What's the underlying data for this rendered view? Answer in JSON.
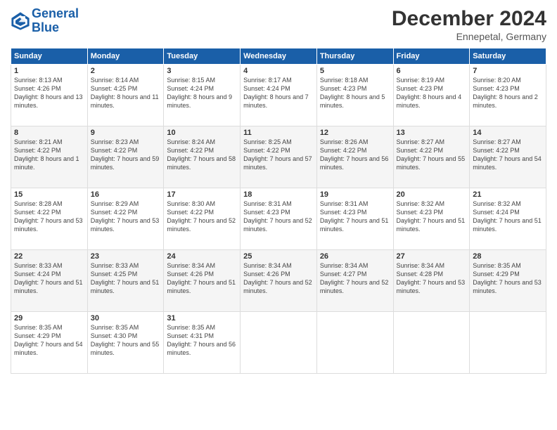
{
  "logo": {
    "line1": "General",
    "line2": "Blue"
  },
  "header": {
    "title": "December 2024",
    "subtitle": "Ennepetal, Germany"
  },
  "weekdays": [
    "Sunday",
    "Monday",
    "Tuesday",
    "Wednesday",
    "Thursday",
    "Friday",
    "Saturday"
  ],
  "weeks": [
    [
      {
        "day": "1",
        "sunrise": "8:13 AM",
        "sunset": "4:26 PM",
        "daylight": "8 hours and 13 minutes."
      },
      {
        "day": "2",
        "sunrise": "8:14 AM",
        "sunset": "4:25 PM",
        "daylight": "8 hours and 11 minutes."
      },
      {
        "day": "3",
        "sunrise": "8:15 AM",
        "sunset": "4:24 PM",
        "daylight": "8 hours and 9 minutes."
      },
      {
        "day": "4",
        "sunrise": "8:17 AM",
        "sunset": "4:24 PM",
        "daylight": "8 hours and 7 minutes."
      },
      {
        "day": "5",
        "sunrise": "8:18 AM",
        "sunset": "4:23 PM",
        "daylight": "8 hours and 5 minutes."
      },
      {
        "day": "6",
        "sunrise": "8:19 AM",
        "sunset": "4:23 PM",
        "daylight": "8 hours and 4 minutes."
      },
      {
        "day": "7",
        "sunrise": "8:20 AM",
        "sunset": "4:23 PM",
        "daylight": "8 hours and 2 minutes."
      }
    ],
    [
      {
        "day": "8",
        "sunrise": "8:21 AM",
        "sunset": "4:22 PM",
        "daylight": "8 hours and 1 minute."
      },
      {
        "day": "9",
        "sunrise": "8:23 AM",
        "sunset": "4:22 PM",
        "daylight": "7 hours and 59 minutes."
      },
      {
        "day": "10",
        "sunrise": "8:24 AM",
        "sunset": "4:22 PM",
        "daylight": "7 hours and 58 minutes."
      },
      {
        "day": "11",
        "sunrise": "8:25 AM",
        "sunset": "4:22 PM",
        "daylight": "7 hours and 57 minutes."
      },
      {
        "day": "12",
        "sunrise": "8:26 AM",
        "sunset": "4:22 PM",
        "daylight": "7 hours and 56 minutes."
      },
      {
        "day": "13",
        "sunrise": "8:27 AM",
        "sunset": "4:22 PM",
        "daylight": "7 hours and 55 minutes."
      },
      {
        "day": "14",
        "sunrise": "8:27 AM",
        "sunset": "4:22 PM",
        "daylight": "7 hours and 54 minutes."
      }
    ],
    [
      {
        "day": "15",
        "sunrise": "8:28 AM",
        "sunset": "4:22 PM",
        "daylight": "7 hours and 53 minutes."
      },
      {
        "day": "16",
        "sunrise": "8:29 AM",
        "sunset": "4:22 PM",
        "daylight": "7 hours and 53 minutes."
      },
      {
        "day": "17",
        "sunrise": "8:30 AM",
        "sunset": "4:22 PM",
        "daylight": "7 hours and 52 minutes."
      },
      {
        "day": "18",
        "sunrise": "8:31 AM",
        "sunset": "4:23 PM",
        "daylight": "7 hours and 52 minutes."
      },
      {
        "day": "19",
        "sunrise": "8:31 AM",
        "sunset": "4:23 PM",
        "daylight": "7 hours and 51 minutes."
      },
      {
        "day": "20",
        "sunrise": "8:32 AM",
        "sunset": "4:23 PM",
        "daylight": "7 hours and 51 minutes."
      },
      {
        "day": "21",
        "sunrise": "8:32 AM",
        "sunset": "4:24 PM",
        "daylight": "7 hours and 51 minutes."
      }
    ],
    [
      {
        "day": "22",
        "sunrise": "8:33 AM",
        "sunset": "4:24 PM",
        "daylight": "7 hours and 51 minutes."
      },
      {
        "day": "23",
        "sunrise": "8:33 AM",
        "sunset": "4:25 PM",
        "daylight": "7 hours and 51 minutes."
      },
      {
        "day": "24",
        "sunrise": "8:34 AM",
        "sunset": "4:26 PM",
        "daylight": "7 hours and 51 minutes."
      },
      {
        "day": "25",
        "sunrise": "8:34 AM",
        "sunset": "4:26 PM",
        "daylight": "7 hours and 52 minutes."
      },
      {
        "day": "26",
        "sunrise": "8:34 AM",
        "sunset": "4:27 PM",
        "daylight": "7 hours and 52 minutes."
      },
      {
        "day": "27",
        "sunrise": "8:34 AM",
        "sunset": "4:28 PM",
        "daylight": "7 hours and 53 minutes."
      },
      {
        "day": "28",
        "sunrise": "8:35 AM",
        "sunset": "4:29 PM",
        "daylight": "7 hours and 53 minutes."
      }
    ],
    [
      {
        "day": "29",
        "sunrise": "8:35 AM",
        "sunset": "4:29 PM",
        "daylight": "7 hours and 54 minutes."
      },
      {
        "day": "30",
        "sunrise": "8:35 AM",
        "sunset": "4:30 PM",
        "daylight": "7 hours and 55 minutes."
      },
      {
        "day": "31",
        "sunrise": "8:35 AM",
        "sunset": "4:31 PM",
        "daylight": "7 hours and 56 minutes."
      },
      null,
      null,
      null,
      null
    ]
  ]
}
